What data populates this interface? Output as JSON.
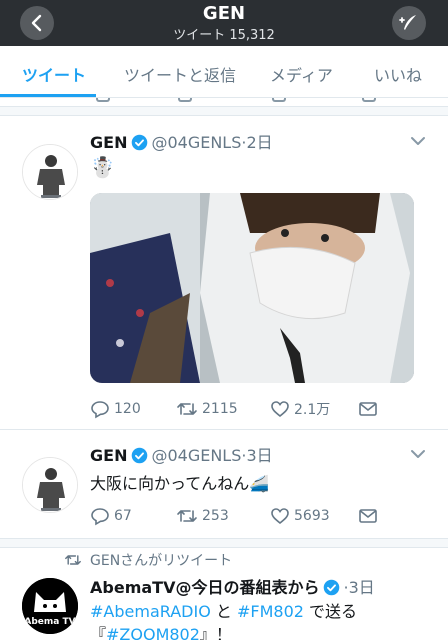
{
  "header": {
    "title": "GEN",
    "subtitle": "ツイート 15,312"
  },
  "tabs": [
    {
      "label": "ツイート",
      "active": true
    },
    {
      "label": "ツイートと返信",
      "active": false
    },
    {
      "label": "メディア",
      "active": false
    },
    {
      "label": "いいね",
      "active": false
    }
  ],
  "tweets": [
    {
      "name": "GEN",
      "handle": "@04GENLS",
      "time": "2日",
      "text": "☃️",
      "has_media": true,
      "replies": "120",
      "retweets": "2115",
      "likes": "2.1万"
    },
    {
      "name": "GEN",
      "handle": "@04GENLS",
      "time": "3日",
      "text": "大阪に向かってんねん🚄",
      "has_media": false,
      "replies": "67",
      "retweets": "253",
      "likes": "5693"
    }
  ],
  "retweet_context": "GENさんがリツイート",
  "abema_tweet": {
    "name": "AbemaTV@今日の番組表から",
    "time": "3日",
    "hashtag1": "#AbemaRADIO",
    "connector": " と ",
    "hashtag2": "#FM802",
    "suffix": " で送る",
    "line3_prefix": "『",
    "hashtag3": "#ZOOM802",
    "line3_suffix": "』！",
    "avatar_text": "Abema TV"
  },
  "colors": {
    "header_bg": "#2b2f33",
    "accent": "#1da1f2",
    "secondary_text": "#657786"
  }
}
